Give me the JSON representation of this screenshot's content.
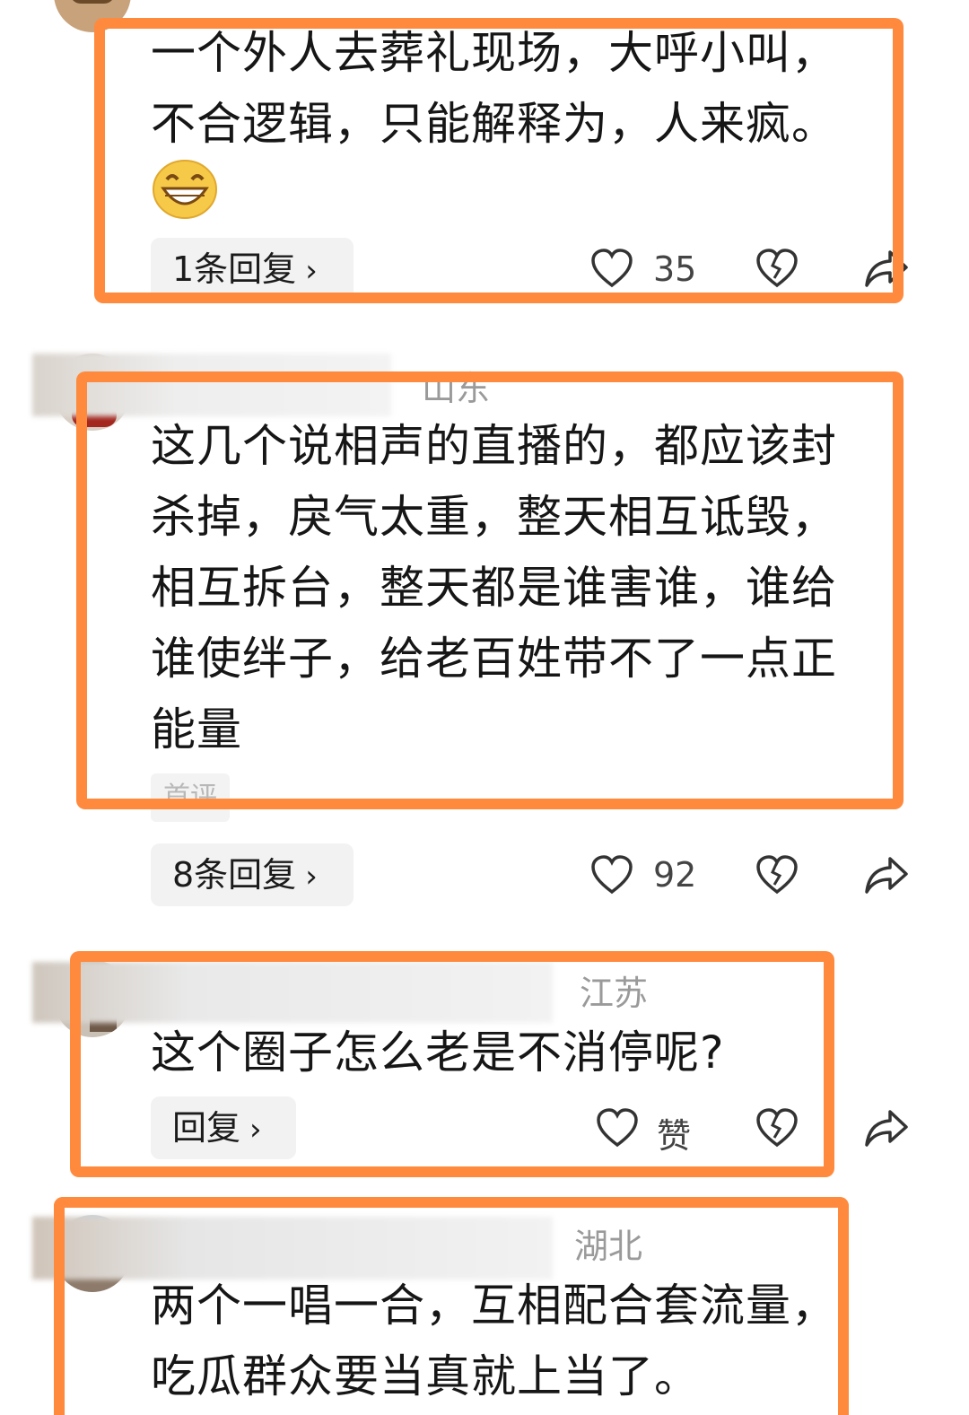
{
  "comments": [
    {
      "body_lines": [
        "一个外人去葬礼现场，大呼小叫，",
        "不合逻辑，只能解释为，人来疯。"
      ],
      "emoji": "grinning-face",
      "reply_label": "1条回复",
      "like_count": "35"
    },
    {
      "location": "山东",
      "body_lines": [
        "这几个说相声的直播的，都应该封",
        "杀掉，戾气太重，整天相互诋毁，",
        "相互拆台，整天都是谁害谁，谁给",
        "谁使绊子，给老百姓带不了一点正",
        "能量"
      ],
      "tag": "首评",
      "reply_label": "8条回复",
      "like_count": "92"
    },
    {
      "location": "江苏",
      "body_lines": [
        "这个圈子怎么老是不消停呢?"
      ],
      "reply_label": "回复",
      "like_count": "赞"
    },
    {
      "location": "湖北",
      "body_lines": [
        "两个一唱一合，互相配合套流量，",
        "吃瓜群众要当真就上当了。"
      ]
    }
  ],
  "highlight_color": "#ff8a3d"
}
